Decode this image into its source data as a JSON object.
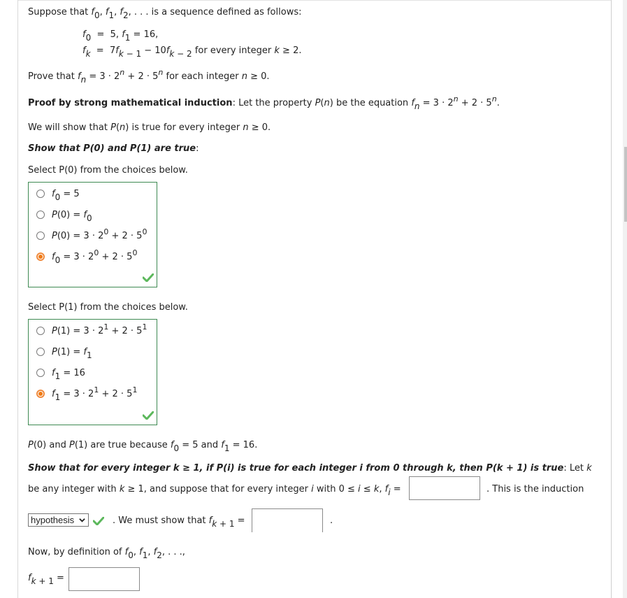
{
  "problem": {
    "intro": "Suppose that",
    "intro_tail": "is a sequence defined as follows:",
    "def_line1": {
      "f0_val": "5",
      "f1_val": "16"
    },
    "def_line2": {
      "coef1": "7",
      "coef2": "10",
      "condition_text": "for every integer",
      "condition_var": "k",
      "condition_rel": "≥ 2."
    },
    "prove": {
      "lead": "Prove that",
      "base1": "3",
      "exp_base1": "2",
      "base2": "2",
      "exp_base2": "5",
      "var": "n",
      "tail": "for each integer",
      "tail_rel": "≥ 0."
    }
  },
  "proof": {
    "heading_bold": "Proof by strong mathematical induction",
    "heading_rest": ": Let the property",
    "heading_rest2": "be the equation",
    "we_will_show": "We will show that",
    "we_will_show_tail": "is true for every integer",
    "we_will_show_rel": "≥ 0.",
    "basis_heading": "Show that P(0) and P(1) are true",
    "basis_colon": ":"
  },
  "question_p0": {
    "prompt": "Select P(0) from the choices below.",
    "choices": [
      {
        "label": "f0 = 5",
        "selected": false
      },
      {
        "label": "P(0) = f0",
        "selected": false
      },
      {
        "label": "P(0) = 3 · 2^0 + 2 · 5^0",
        "selected": false
      },
      {
        "label": "f0 = 3 · 2^0 + 2 · 5^0",
        "selected": true
      }
    ],
    "status": "correct"
  },
  "question_p1": {
    "prompt": "Select P(1) from the choices below.",
    "choices": [
      {
        "label": "P(1) = 3 · 2^1 + 2 · 5^1",
        "selected": false
      },
      {
        "label": "P(1) = f1",
        "selected": false
      },
      {
        "label": "f1 = 16",
        "selected": false
      },
      {
        "label": "f1 = 3 · 2^1 + 2 · 5^1",
        "selected": true
      }
    ],
    "status": "correct"
  },
  "basis_conclusion": {
    "text_a": "and",
    "text_b": "are true because",
    "f0_val": "= 5 and",
    "f1_val": "= 16."
  },
  "inductive": {
    "heading": "Show that for every integer k ≥ 1, if P(i) is true for each integer i from 0 through k, then P(k + 1) is true",
    "heading_colon": ": Let",
    "heading_var": "k",
    "line2_a": "be any integer with",
    "line2_b": "≥ 1, and suppose that for every integer",
    "line2_c": "with 0 ≤",
    "line2_d": "≤",
    "line2_e": ",",
    "fi_input": {
      "value": "",
      "placeholder": ""
    },
    "line2_tail": ". This is the induction",
    "hypothesis_select": {
      "selected": "hypothesis",
      "status": "correct"
    },
    "must_show": ". We must show that",
    "fk1_input": {
      "value": "",
      "placeholder": ""
    },
    "must_show_tail": ".",
    "now_text": "Now, by definition of",
    "def_input": {
      "value": "",
      "placeholder": ""
    }
  },
  "colors": {
    "correct_border": "#3e8a52",
    "check": "#5cb85c",
    "radio_selected": "#f07a14"
  }
}
